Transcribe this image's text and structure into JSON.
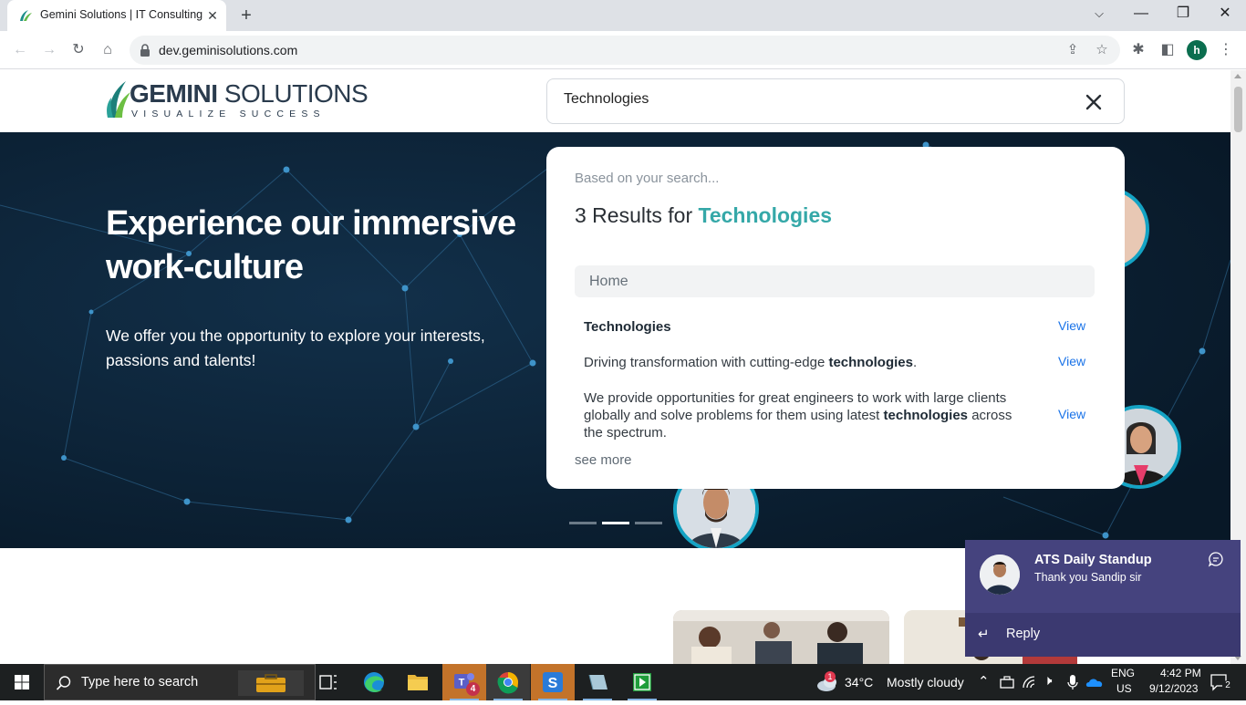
{
  "browser": {
    "tab_title": "Gemini Solutions | IT Consulting, Software",
    "url": "dev.geminisolutions.com",
    "profile_initial": "h"
  },
  "header": {
    "logo_main": "GEMINI",
    "logo_main_rest": " SOLUTIONS",
    "logo_tag": "VISUALIZE SUCCESS",
    "search_value": "Technologies"
  },
  "hero": {
    "heading": "Experience our immersive work-culture",
    "subtext": "We offer you the opportunity to explore your interests, passions and talents!"
  },
  "search_results": {
    "based_on": "Based on your search...",
    "count_prefix": "3 Results for ",
    "term": "Technologies",
    "section": "Home",
    "items": [
      {
        "pre": "",
        "bold": "Technologies",
        "post": "",
        "view": "View"
      },
      {
        "pre": "Driving transformation with cutting-edge ",
        "bold": "technologies",
        "post": ".",
        "view": "View"
      },
      {
        "pre": "We provide opportunities for great engineers to work with large clients globally and solve problems for them using latest ",
        "bold": "technologies",
        "post": " across the spectrum.",
        "view": "View"
      }
    ],
    "see_more": "see more"
  },
  "toast": {
    "sender": "ATS Daily Standup",
    "message": "Thank you Sandip sir",
    "reply": "Reply"
  },
  "taskbar": {
    "search_placeholder": "Type here to search",
    "teams_badge": "4",
    "weather_temp": "34°C",
    "weather_text": "Mostly cloudy",
    "weather_alert": "1",
    "lang": "ENG",
    "region": "US",
    "time": "4:42 PM",
    "date": "9/12/2023",
    "notif_count": "2"
  },
  "colors": {
    "accent_teal": "#35a8a8",
    "hero_bg": "#0b2034",
    "link": "#1a73e8",
    "teams_toast": "#45437e"
  }
}
